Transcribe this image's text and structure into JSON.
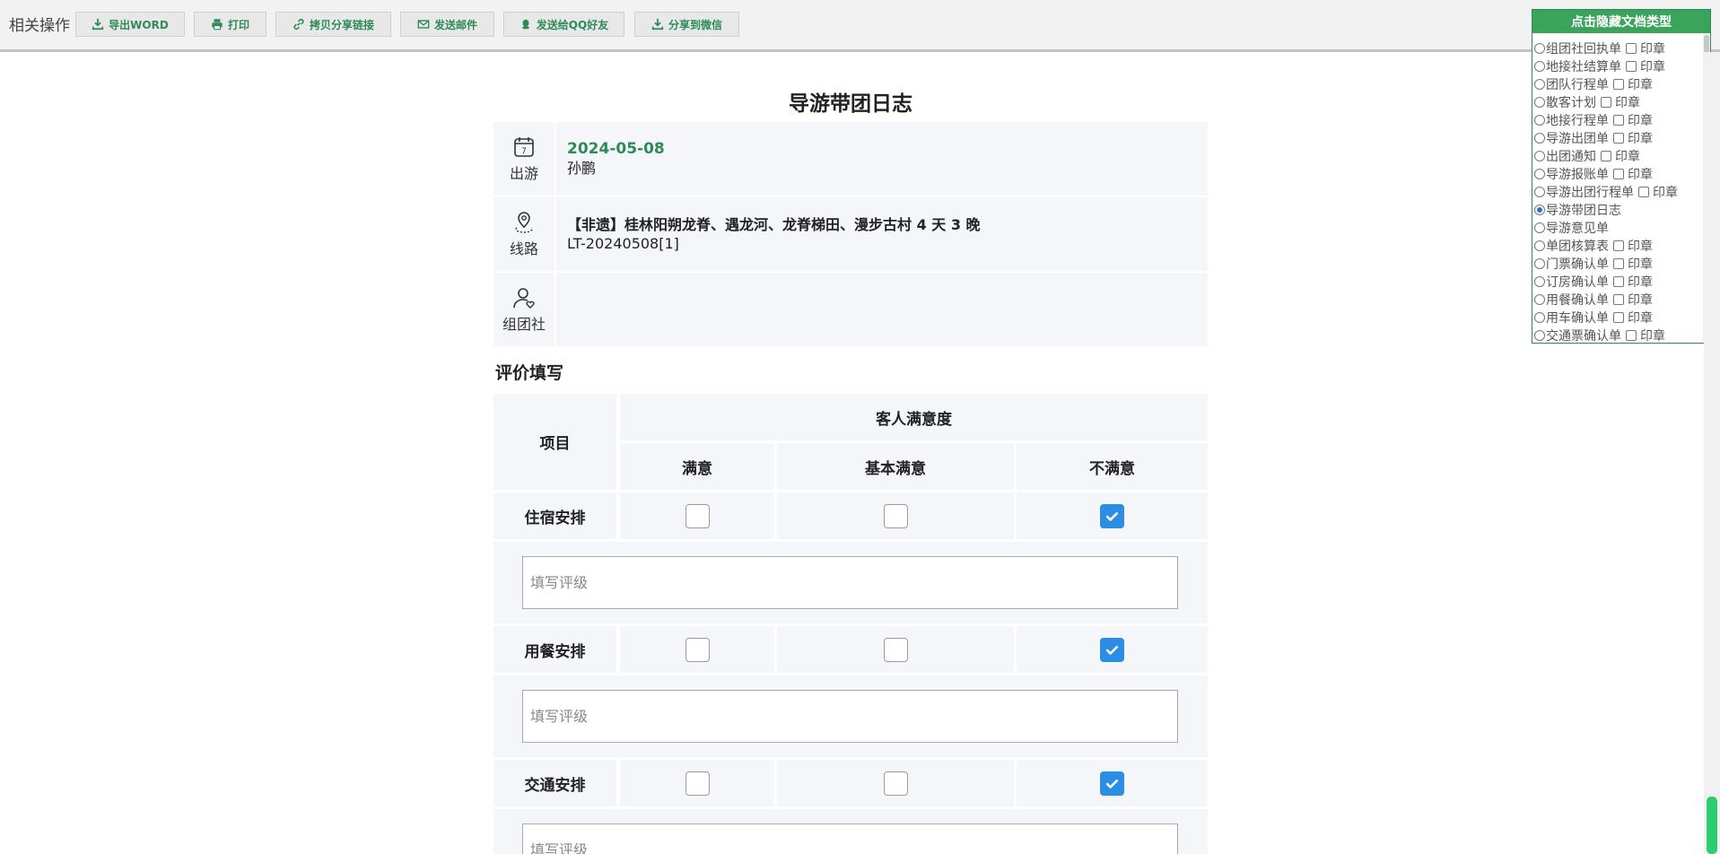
{
  "toolbar": {
    "title": "相关操作",
    "buttons": [
      {
        "label": "导出WORD",
        "icon": "download-icon"
      },
      {
        "label": "打印",
        "icon": "print-icon"
      },
      {
        "label": "拷贝分享链接",
        "icon": "link-icon"
      },
      {
        "label": "发送邮件",
        "icon": "mail-icon"
      },
      {
        "label": "发送给QQ好友",
        "icon": "qq-icon"
      },
      {
        "label": "分享到微信",
        "icon": "download-icon"
      }
    ]
  },
  "document": {
    "title": "导游带团日志",
    "info": {
      "travel": {
        "label": "出游",
        "date": "2024-05-08",
        "guide": "孙鹏"
      },
      "route": {
        "label": "线路",
        "name": "【非遗】桂林阳朔龙脊、遇龙河、龙脊梯田、漫步古村 4 天 3 晚",
        "code": "LT-20240508[1]"
      },
      "agency": {
        "label": "组团社",
        "value": ""
      }
    }
  },
  "evaluation": {
    "section_title": "评价填写",
    "header": {
      "item": "项目",
      "group": "客人满意度",
      "columns": [
        "满意",
        "基本满意",
        "不满意"
      ]
    },
    "rows": [
      {
        "label": "住宿安排",
        "checked": [
          false,
          false,
          true
        ],
        "placeholder": "填写评级"
      },
      {
        "label": "用餐安排",
        "checked": [
          false,
          false,
          true
        ],
        "placeholder": "填写评级"
      },
      {
        "label": "交通安排",
        "checked": [
          false,
          false,
          true
        ],
        "placeholder": "填写评级"
      }
    ]
  },
  "doc_panel": {
    "header": "点击隐藏文档类型",
    "stamp_label": "印章",
    "items": [
      {
        "label": "组团社回执单",
        "selected": false,
        "stamp": true
      },
      {
        "label": "地接社结算单",
        "selected": false,
        "stamp": true
      },
      {
        "label": "团队行程单",
        "selected": false,
        "stamp": true
      },
      {
        "label": "散客计划",
        "selected": false,
        "stamp": true
      },
      {
        "label": "地接行程单",
        "selected": false,
        "stamp": true
      },
      {
        "label": "导游出团单",
        "selected": false,
        "stamp": true
      },
      {
        "label": "出团通知",
        "selected": false,
        "stamp": true
      },
      {
        "label": "导游报账单",
        "selected": false,
        "stamp": true
      },
      {
        "label": "导游出团行程单",
        "selected": false,
        "stamp": true
      },
      {
        "label": "导游带团日志",
        "selected": true,
        "stamp": false
      },
      {
        "label": "导游意见单",
        "selected": false,
        "stamp": false
      },
      {
        "label": "单团核算表",
        "selected": false,
        "stamp": true
      },
      {
        "label": "门票确认单",
        "selected": false,
        "stamp": true
      },
      {
        "label": "订房确认单",
        "selected": false,
        "stamp": true
      },
      {
        "label": "用餐确认单",
        "selected": false,
        "stamp": true
      },
      {
        "label": "用车确认单",
        "selected": false,
        "stamp": true
      },
      {
        "label": "交通票确认单",
        "selected": false,
        "stamp": true
      }
    ]
  },
  "colors": {
    "accent": "#2e8b57",
    "checkbox_checked": "#2b8de4",
    "panel_header": "#3aa35c",
    "row_bg": "#f5f6fa"
  }
}
